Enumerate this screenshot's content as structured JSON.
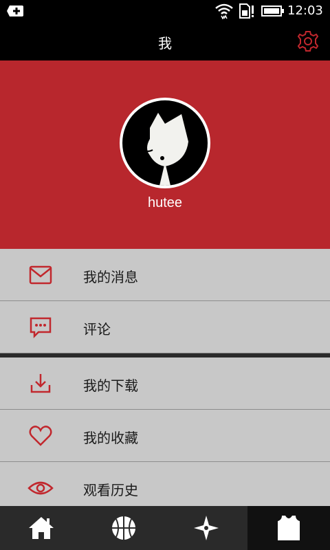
{
  "status_bar": {
    "time": "12:03",
    "icons": [
      "usb-debug-icon",
      "wifi-icon",
      "sim-icon",
      "battery-icon"
    ]
  },
  "header": {
    "title": "我",
    "settings_icon": "gear-icon"
  },
  "profile": {
    "username": "hutee",
    "avatar_icon": "avatar-cat-icon"
  },
  "colors": {
    "accent": "#b8272d",
    "menu_bg": "#c8c8c8",
    "header_bg": "#000000",
    "nav_bg": "#2a2a2a"
  },
  "menu": {
    "items": [
      {
        "label": "我的消息",
        "icon": "envelope-icon"
      },
      {
        "label": "评论",
        "icon": "comment-icon"
      },
      {
        "label": "我的下载",
        "icon": "download-icon"
      },
      {
        "label": "我的收藏",
        "icon": "heart-icon"
      },
      {
        "label": "观看历史",
        "icon": "eye-icon"
      }
    ]
  },
  "bottom_nav": {
    "items": [
      {
        "icon": "home-icon",
        "active": false
      },
      {
        "icon": "basketball-icon",
        "active": false
      },
      {
        "icon": "compass-icon",
        "active": false
      },
      {
        "icon": "jersey-icon",
        "active": true
      }
    ]
  }
}
